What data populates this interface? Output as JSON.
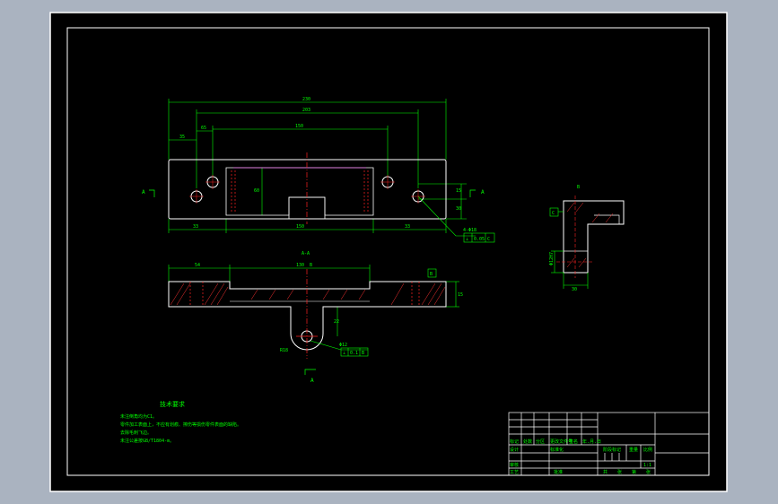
{
  "colors": {
    "background": "#000000",
    "frame": "#ffffff",
    "outline": "#ffffff",
    "dimension": "#00ff00",
    "centerline": "#ff2222",
    "hatch": "#ff3333",
    "leader": "#00ffff",
    "magenta": "#ff44ff"
  },
  "drawing": {
    "top_view": {
      "dim_overall": "230",
      "dim_mid": "203",
      "dim_inner": "150",
      "dim_left": "35",
      "dim_small": "65",
      "dim_bottom_left": "33",
      "dim_bottom_mid": "150",
      "dim_bottom_right": "33",
      "dim_height": "60",
      "dim_right_a": "15",
      "dim_right_b": "30",
      "section_left": "A",
      "section_right": "A",
      "hole_callout": "4-Φ18",
      "tol_sym": "⊥",
      "tol_val": "0.05",
      "tol_ref": "C"
    },
    "front_view": {
      "title": "A-A",
      "dim_left": "54",
      "dim_top": "130",
      "dim_top_b": "B",
      "dim_thick": "15",
      "dim_right": "15",
      "dim_stem": "22",
      "dim_radius": "R18",
      "hole_callout": "Φ12",
      "tol_sym": "⊥",
      "tol_val": "0.1",
      "tol_ref": "B",
      "datum_box": "B",
      "section_marker": "A"
    },
    "side_view": {
      "title": "B",
      "datum": "C",
      "dim_hole": "Φ12H7",
      "dim_width": "30"
    },
    "notes": {
      "title": "技术要求",
      "items": [
        "未注倒角均为C1。",
        "零件加工表面上，不应有划痕、擦伤等损伤零件表面的缺陷。",
        "去除毛刺飞边。",
        "未注公差按GB/T1804-m。"
      ]
    },
    "title_block": {
      "row_labels": [
        "标记",
        "处数",
        "分区",
        "更改文件号",
        "签名",
        "年.月.日"
      ],
      "left_labels": [
        "设计",
        "审核",
        "工艺"
      ],
      "std_label": "标准化",
      "approve_label": "批准",
      "stage_label": "阶段标记",
      "weight_label": "重量",
      "scale_label": "比例",
      "scale_value": "1:1",
      "sheet_labels": [
        "共",
        "张",
        "第",
        "张"
      ]
    }
  }
}
